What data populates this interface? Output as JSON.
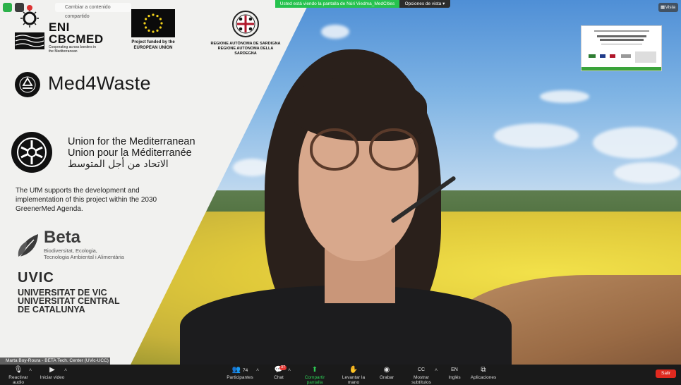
{
  "top_bar": {
    "share_notice": "Cambiar a contenido compartido",
    "viewing_banner": "Usted está viendo la pantalla de Núri Viedma_MedCities",
    "view_options": "Opciones de vista",
    "view_button": "Vista"
  },
  "slide_logos": {
    "eni_title_1": "ENI",
    "eni_title_2": "CBCMED",
    "eni_sub": "Cooperating across borders in the Mediterranean",
    "eu_caption_1": "Project funded by the",
    "eu_caption_2": "EUROPEAN UNION",
    "sardegna_1": "REGIONE AUTÒNOMA DE SARDIGNA",
    "sardegna_2": "REGIONE AUTONOMA DELLA SARDEGNA",
    "med4waste": "Med4Waste",
    "ufm_en": "Union for the Mediterranean",
    "ufm_fr": "Union pour la Méditerranée",
    "ufm_ar": "الاتحاد من أجل المتوسط",
    "ufm_paragraph": "The UfM supports the development and implementation of this project within the 2030 GreenerMed Agenda.",
    "beta_title": "Beta",
    "beta_sub_1": "Biodiversitat, Ecologia,",
    "beta_sub_2": "Tecnologia Ambiental i Alimentària",
    "uvic_title": "UVIC",
    "uvic_1": "UNIVERSITAT DE VIC",
    "uvic_2": "UNIVERSITAT CENTRAL",
    "uvic_3": "DE CATALUNYA"
  },
  "participant_name": "Marta Boy-Roura - BETA Tech. Center (UVic-UCC)",
  "toolbar": {
    "audio": "Reactivar audio",
    "video": "Iniciar video",
    "participants": "Participantes",
    "participants_count": "74",
    "chat": "Chat",
    "chat_badge": "37",
    "share": "Compartir pantalla",
    "raise_hand": "Levantar la mano",
    "record": "Grabar",
    "subtitles": "Mostrar subtítulos",
    "subtitles_icon": "CC",
    "language": "Inglés",
    "language_icon": "EN",
    "apps": "Aplicaciones",
    "leave": "Salir"
  },
  "colors": {
    "banner_green": "#26c24e",
    "leave_red": "#e0291f",
    "share_green": "#2ecc55"
  }
}
